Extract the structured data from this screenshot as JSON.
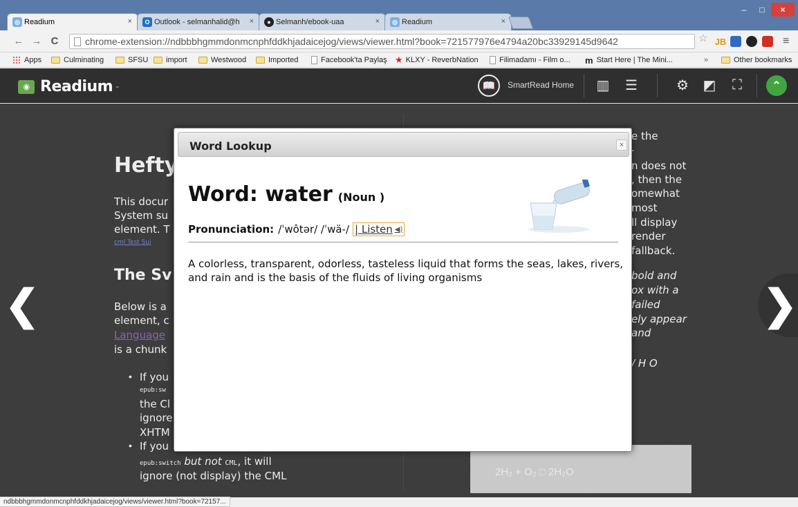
{
  "browser": {
    "tabs": [
      {
        "label": "Readium",
        "active": true
      },
      {
        "label": "Outlook - selmanhalid@h",
        "active": false
      },
      {
        "label": "Selmanh/ebook-uaa",
        "active": false
      },
      {
        "label": "Readium",
        "active": false
      }
    ],
    "tab_close": "×",
    "window_controls": {
      "minimize": "–",
      "maximize": "□",
      "close": "×"
    },
    "nav": {
      "back": "←",
      "forward": "→",
      "reload": "C"
    },
    "url": "chrome-extension://ndbbbhgmmdonmcnphfddkhjadaicejog/views/viewer.html?book=721577976e4794a20bc33929145d9642",
    "star": "☆",
    "extensions": [
      "JB",
      "",
      "",
      ""
    ],
    "menu": "≡"
  },
  "bookmarks": {
    "items": [
      "Apps",
      "Culminating",
      "SFSU",
      "import",
      "Westwood",
      "Imported",
      "Facebook'ta Paylaş",
      "KLXY - ReverbNation",
      "Filimadamı - Film o...",
      "Start Here | The Mini..."
    ],
    "overflow": "»",
    "other": "Other bookmarks"
  },
  "readium": {
    "logo": "Readium",
    "logo_dash": "-",
    "smartread_label": "SmartRead Home"
  },
  "page_left": {
    "heading1": "Hefty",
    "p1_lines": [
      "This docur",
      "System su",
      "element. T"
    ],
    "small_link": "cml Test Sui",
    "heading2": "The Sv",
    "p2_lines": [
      "Below is a",
      "element, c"
    ],
    "link": "Language",
    "p2_last": "is a chunk",
    "bullet1_lines": [
      "If you",
      "epub:sw",
      "the Cl",
      "ignore",
      "XHTM"
    ],
    "bullet2_first": "If you",
    "bullet2_mono": "epub:switch",
    "bullet2_italic": "but not",
    "bullet2_cml": "CML",
    "bullet2_rest": ", it will",
    "bullet2_last": "ignore (not display) the CML"
  },
  "page_right": {
    "lines": [
      "e the",
      ".",
      "n does not",
      ", then the",
      "omewhat",
      "most",
      "ll display",
      "render",
      "fallback."
    ],
    "italic_lines": [
      "bold and",
      "ox with a",
      "failed",
      "ely appear",
      "and"
    ],
    "formula_tail": "/ H O",
    "fallback_formula": "2H₂ + O₂ □ 2H₂O"
  },
  "modal": {
    "title": "Word Lookup",
    "close": "×",
    "word_label": "Word: water",
    "part_of_speech": "(Noun )",
    "pronunciation_label": "Pronunciation:",
    "pronunciation": "/ˈwôtər/ /ˈwä-/",
    "listen": "| Listen",
    "speaker_icon": "◀)",
    "definition": "A colorless, transparent, odorless, tasteless liquid that forms the seas, lakes, rivers, and rain and is the basis of the fluids of living organisms"
  },
  "status_url": "ndbbbhgmmdonmcnphfddkhjadaicejog/views/viewer.html?book=72157..."
}
